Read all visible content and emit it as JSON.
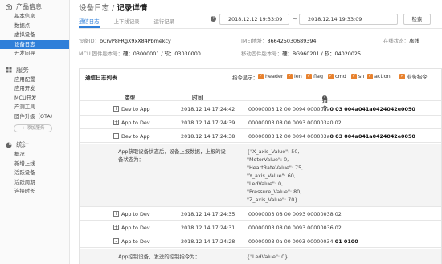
{
  "sidebar": {
    "sections": [
      {
        "title": "产品信息",
        "icon": "cube-icon",
        "items": [
          "基本信息",
          "数据点",
          "虚拟设备",
          "设备日志",
          "开发向导"
        ]
      },
      {
        "title": "服务",
        "icon": "grid-icon",
        "items": [
          "应用配置",
          "应用开发",
          "MCU开发",
          "产测工具",
          "固件升级（OTA）"
        ],
        "add_label": "+ 添加服务"
      },
      {
        "title": "统计",
        "icon": "pie-icon",
        "items": [
          "概况",
          "新增上线",
          "活跃设备",
          "活跃周期",
          "连接时长"
        ]
      }
    ],
    "active": "设备日志"
  },
  "breadcrumb": {
    "parent": "设备日志",
    "sep": " / ",
    "current": "记录详情"
  },
  "tabs": [
    "通信日志",
    "上下线记录",
    "运行记录"
  ],
  "help": "?",
  "date_from": "2018.12.12 19:33:09",
  "date_sep": "~",
  "date_to": "2018.12.14 19:33:09",
  "search_label": "检索",
  "device": {
    "did_label": "设备ID：",
    "did": "bCrvP8FRgX9xX84Pbmekcy",
    "imei_label": "IMEI地址：",
    "imei": "866425030689394",
    "online_label": "在线状态：",
    "online": "离线",
    "mcu_label": "MCU 固件版本号：",
    "mcu": "硬：03000001 / 软：03030000",
    "mod_label": "移动固件版本号：",
    "mod": "硬：BG960201 / 软：04020025"
  },
  "panel": {
    "title": "通信日志列表",
    "filter_label": "指令显示：",
    "filters": [
      "header",
      "len",
      "flag",
      "cmd",
      "sn",
      "action",
      "业务指令"
    ],
    "columns": {
      "type": "类型",
      "time": "时间",
      "cmd": "指令"
    }
  },
  "rows": [
    {
      "expand": "+",
      "type": "Dev to App",
      "time": "2018.12.14 17:24:42",
      "cmd": "00000003  12  00  0094  000003a",
      "cmd_b": "0  03  004a041a0424042e0050"
    },
    {
      "expand": "+",
      "type": "App to Dev",
      "time": "2018.12.14 17:24:39",
      "cmd": "00000003  08  00  0093  000003a0  02",
      "cmd_b": ""
    },
    {
      "expand": "-",
      "type": "Dev to App",
      "time": "2018.12.14 17:24:38",
      "cmd": "00000003  12  00  0094  000003a",
      "cmd_b": "0  03  004a041a0424042e0050"
    },
    {
      "expand": "+",
      "type": "App to Dev",
      "time": "2018.12.14 17:24:35",
      "cmd": "00000003  08  00  0093  00000038  02",
      "cmd_b": ""
    },
    {
      "expand": "+",
      "type": "App to Dev",
      "time": "2018.12.14 17:24:31",
      "cmd": "00000003  08  00  0093  00000036  02",
      "cmd_b": ""
    },
    {
      "expand": "-",
      "type": "App to Dev",
      "time": "2018.12.14 17:24:28",
      "cmd": "00000003  0a  00  0093  00000034",
      "cmd_b": "  01  0100"
    }
  ],
  "detail1": {
    "desc": [
      "App获取设备状态后，设备上报数据，上报的设",
      "备状态为："
    ],
    "json": [
      "{\"X_axis_Value\": 50,",
      "\"MotorValue\": 0,",
      "\"HeartRateValue\": 75,",
      "\"Y_axis_Value\": 60,",
      "\"LedValue\": 0,",
      "\"Pressure_Value\": 80,",
      "\"Z_axis_Value\": 70}"
    ]
  },
  "detail2": {
    "desc": [
      "App控制设备，发送的控制指令为："
    ],
    "json": [
      "{\"LedValue\": 0}"
    ]
  }
}
